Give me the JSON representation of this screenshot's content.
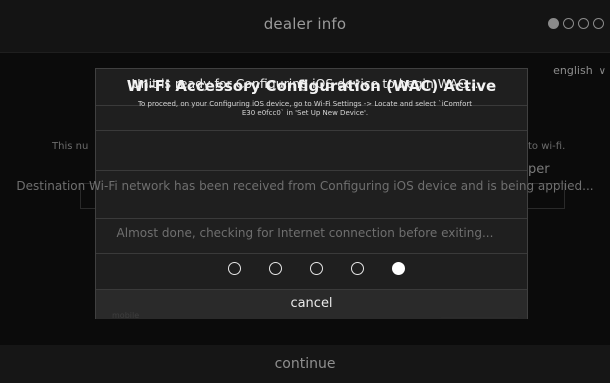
{
  "header": {
    "title": "dealer info",
    "page_indicator": {
      "total": 4,
      "current": 1
    }
  },
  "language": {
    "selected": "english"
  },
  "background": {
    "left_fragment": "This nu",
    "right_fragment": "to wi-fi.",
    "right_fragment2": "per",
    "bottom_fragment": "mobile"
  },
  "modal": {
    "title": "Wi-Fi Accessory Configuration (WAC) Active",
    "ready_text": "Unit is ready for Configuring iOS device to begin WAC...",
    "instructions_line1": "To proceed, on your Configuring iOS device, go to Wi-Fi Settings -> Locate and select `iComfort",
    "instructions_line2": "E30 e0fcc0` in 'Set Up New Device'.",
    "destination_text": "Destination Wi-Fi network has been received from Configuring iOS device and is being applied...",
    "almost_done_text": "Almost done, checking for Internet connection before exiting...",
    "progress": {
      "steps": 5,
      "active_index": 4
    },
    "cancel_label": "cancel"
  },
  "footer": {
    "continue_label": "continue"
  },
  "colors": {
    "background": "#0b0b0b",
    "modal_bg": "#1f1f1f",
    "accent_text": "#ffffff",
    "dim_text": "#6f6f6f"
  }
}
